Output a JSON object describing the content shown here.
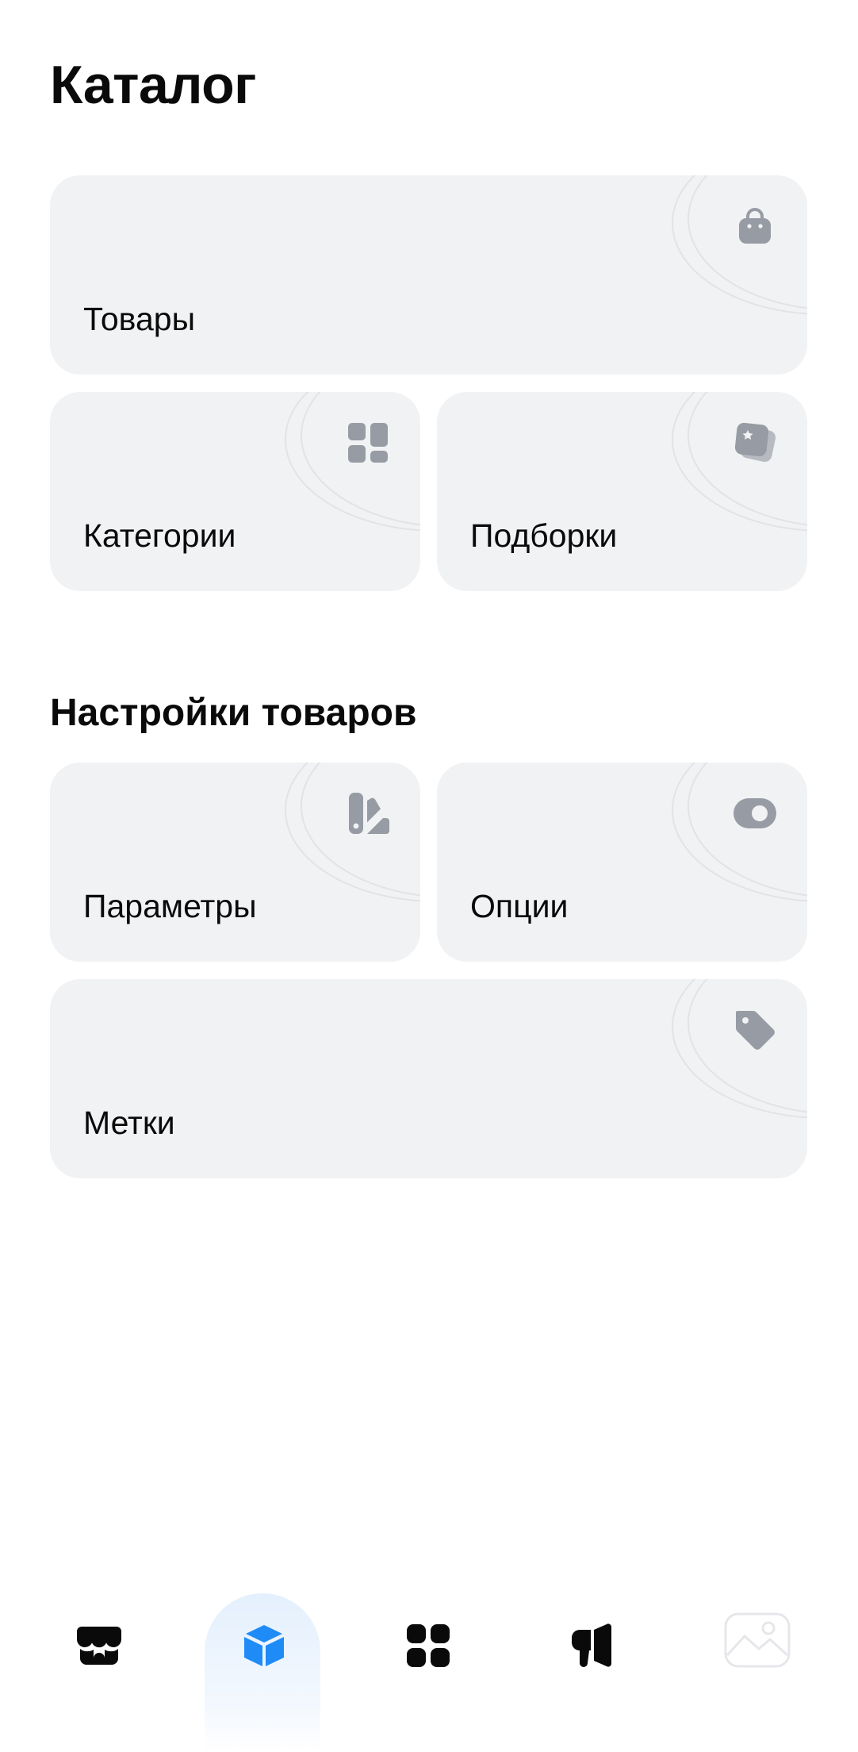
{
  "header": {
    "title": "Каталог"
  },
  "catalog_cards": {
    "products": {
      "label": "Товары",
      "icon": "shopping-bag-icon"
    },
    "categories": {
      "label": "Категории",
      "icon": "grid-tiles-icon"
    },
    "collections": {
      "label": "Подборки",
      "icon": "stacked-cards-star-icon"
    }
  },
  "settings_section": {
    "title": "Настройки товаров",
    "cards": {
      "parameters": {
        "label": "Параметры",
        "icon": "swatches-icon"
      },
      "options": {
        "label": "Опции",
        "icon": "toggle-icon"
      },
      "tags": {
        "label": "Метки",
        "icon": "tag-icon"
      }
    }
  },
  "bottom_nav": {
    "active": "catalog",
    "items": [
      {
        "id": "shop",
        "icon": "storefront-icon"
      },
      {
        "id": "catalog",
        "icon": "cube-icon"
      },
      {
        "id": "apps",
        "icon": "apps-grid-icon"
      },
      {
        "id": "promo",
        "icon": "megaphone-icon"
      },
      {
        "id": "profile",
        "icon": "image-placeholder-icon"
      }
    ]
  },
  "colors": {
    "card_background": "#f1f2f4",
    "icon_gray": "#979ca4",
    "accent_blue": "#1e8bf7",
    "text": "#0a0a0a"
  }
}
